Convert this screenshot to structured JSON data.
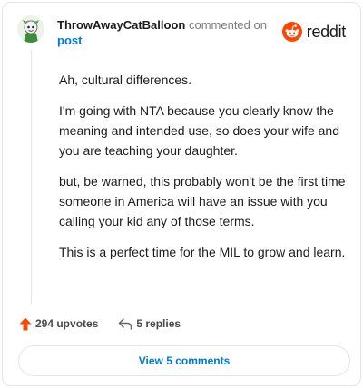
{
  "header": {
    "username": "ThrowAwayCatBalloon",
    "action_text": "commented on",
    "post_link_text": "post"
  },
  "brand": {
    "name": "reddit",
    "color": "#ff4500"
  },
  "comment": {
    "paragraphs": [
      "Ah, cultural differences.",
      "I'm going with NTA because you clearly know the meaning and intended use, so does your wife and you are teaching your daughter.",
      "but, be warned, this probably won't be the first time someone in America will have an issue with you calling your kid any of those terms.",
      "This is a perfect time for the MIL to grow and learn."
    ]
  },
  "actions": {
    "upvotes_label": "294 upvotes",
    "replies_label": "5 replies"
  },
  "view_button": {
    "label": "View 5 comments"
  },
  "icons": {
    "upvote": "upvote-arrow-icon",
    "reply": "reply-arrow-icon",
    "brand": "reddit-logo-icon",
    "avatar": "user-avatar"
  },
  "colors": {
    "accent": "#0079d3",
    "upvote": "#ff4500",
    "muted": "#7c7c7c"
  }
}
